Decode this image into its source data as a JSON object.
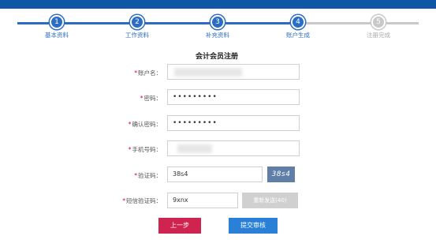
{
  "steps": [
    {
      "number": "1",
      "label": "基本资料",
      "state": "done"
    },
    {
      "number": "2",
      "label": "工作资料",
      "state": "done"
    },
    {
      "number": "3",
      "label": "补充资料",
      "state": "done"
    },
    {
      "number": "4",
      "label": "账户生成",
      "state": "current"
    },
    {
      "number": "5",
      "label": "注册完成",
      "state": "todo"
    }
  ],
  "form": {
    "title": "会计会员注册",
    "required_mark": "*",
    "account": {
      "label": "账户名：",
      "value": ""
    },
    "password": {
      "label": "密码：",
      "value": "•••••••••"
    },
    "confirm_password": {
      "label": "确认密码：",
      "value": "•••••••••"
    },
    "phone": {
      "label": "手机号码：",
      "value": ""
    },
    "captcha": {
      "label": "验证码：",
      "value": "38s4",
      "image_text": "38s4"
    },
    "sms_code": {
      "label": "短信验证码：",
      "value": "9xnx",
      "resend_label": "重新发送(40)"
    }
  },
  "buttons": {
    "prev": "上一步",
    "submit": "提交审核"
  },
  "colors": {
    "primary": "#2b6cc4",
    "header": "#0f57a6",
    "pending": "#c9c9c9",
    "danger": "#cf2450",
    "submit": "#2980d6"
  }
}
